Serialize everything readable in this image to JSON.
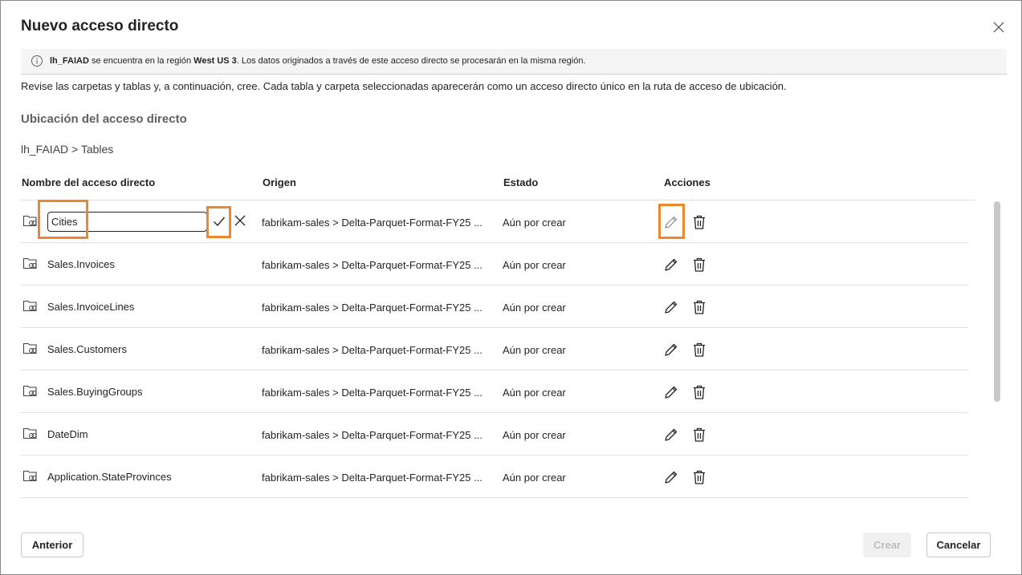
{
  "dialog": {
    "title": "Nuevo acceso directo",
    "banner": {
      "lakehouse": "lh_FAIAD",
      "text_1": " se encuentra en la región ",
      "region": "West US 3",
      "text_2": ". Los datos originados a través de este acceso directo se procesarán en la misma región."
    },
    "description": "Revise las carpetas y tablas y, a continuación, cree. Cada tabla y carpeta seleccionadas aparecerán como un acceso directo único en la ruta de acceso de ubicación.",
    "location_title": "Ubicación del acceso directo",
    "breadcrumb": "lh_FAIAD > Tables",
    "columns": {
      "name": "Nombre del acceso directo",
      "origin": "Origen",
      "state": "Estado",
      "actions": "Acciones"
    },
    "rows": [
      {
        "name": "Cities",
        "origin": "fabrikam-sales > Delta-Parquet-Format-FY25 ...",
        "state": "Aún por crear",
        "editing": true
      },
      {
        "name": "Sales.Invoices",
        "origin": "fabrikam-sales > Delta-Parquet-Format-FY25 ...",
        "state": "Aún por crear"
      },
      {
        "name": "Sales.InvoiceLines",
        "origin": "fabrikam-sales > Delta-Parquet-Format-FY25 ...",
        "state": "Aún por crear"
      },
      {
        "name": "Sales.Customers",
        "origin": "fabrikam-sales > Delta-Parquet-Format-FY25 ...",
        "state": "Aún por crear"
      },
      {
        "name": "Sales.BuyingGroups",
        "origin": "fabrikam-sales > Delta-Parquet-Format-FY25 ...",
        "state": "Aún por crear"
      },
      {
        "name": "DateDim",
        "origin": "fabrikam-sales > Delta-Parquet-Format-FY25 ...",
        "state": "Aún por crear"
      },
      {
        "name": "Application.StateProvinces",
        "origin": "fabrikam-sales > Delta-Parquet-Format-FY25 ...",
        "state": "Aún por crear"
      }
    ],
    "buttons": {
      "previous": "Anterior",
      "create": "Crear",
      "cancel": "Cancelar"
    },
    "colors": {
      "highlight": "#f0862a",
      "disabled_text": "#bdbdbd"
    },
    "icons": [
      "info-icon",
      "close-icon",
      "folder-link-icon",
      "check-icon",
      "dismiss-icon",
      "pencil-icon",
      "trash-icon"
    ]
  }
}
